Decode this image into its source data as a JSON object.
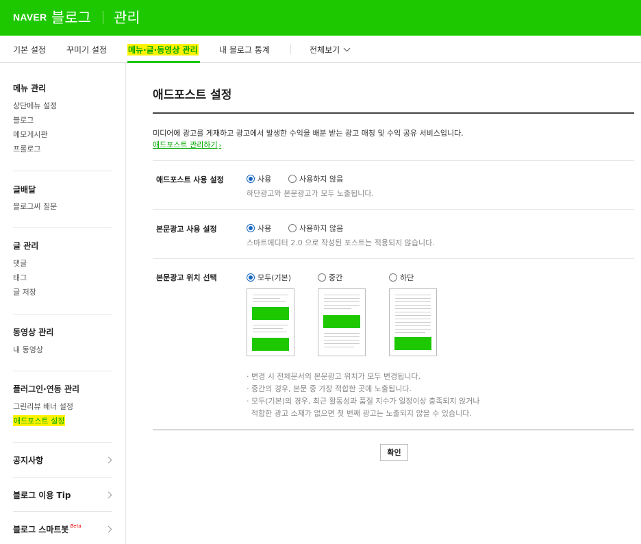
{
  "header": {
    "logo": "NAVER",
    "blog": "블로그",
    "manage": "관리",
    "background": "#1ec800"
  },
  "nav": {
    "tabs": [
      "기본 설정",
      "꾸미기 설정",
      "메뉴·글·동영상 관리",
      "내 블로그 통계"
    ],
    "view_all": "전체보기",
    "active_index": 2
  },
  "sidebar": {
    "menu_manage": {
      "title": "메뉴 관리",
      "items": [
        "상단메뉴 설정",
        "블로그",
        "메모게시판",
        "프롤로그"
      ]
    },
    "delivery": {
      "title": "글배달",
      "items": [
        "블로그씨 질문"
      ]
    },
    "post_manage": {
      "title": "글 관리",
      "items": [
        "댓글",
        "태그",
        "글 저장"
      ]
    },
    "video_manage": {
      "title": "동영상 관리",
      "items": [
        "내 동영상"
      ]
    },
    "plugin_manage": {
      "title": "플러그인·연동 관리",
      "items": [
        "그린리뷰 배너 설정",
        "애드포스트 설정"
      ]
    },
    "links": [
      "공지사항",
      "블로그 이용 Tip",
      "블로그 스마트봇"
    ],
    "beta": "Beta"
  },
  "main": {
    "title": "애드포스트 설정",
    "description": "미디어에 광고를 게재하고 광고에서 발생한 수익을 배분 받는 광고 매칭 및 수익 공유 서비스입니다.",
    "manage_link": "애드포스트 관리하기",
    "rows": [
      {
        "label": "애드포스트 사용 설정",
        "options": [
          "사용",
          "사용하지 않음"
        ],
        "selected": 0,
        "note": "하단광고와 본문광고가 모두 노출됩니다."
      },
      {
        "label": "본문광고 사용 설정",
        "options": [
          "사용",
          "사용하지 않음"
        ],
        "selected": 0,
        "note": "스마트에디터 2.0 으로 작성된 포스트는 적용되지 않습니다."
      },
      {
        "label": "본문광고 위치 선택",
        "options": [
          "모두(기본)",
          "중간",
          "하단"
        ],
        "selected": 0
      }
    ],
    "notes": [
      "· 변경 시 전체문서의 본문광고 위치가 모두 변경됩니다.",
      "· 중간의 경우, 본문 중 가장 적합한 곳에 노출됩니다.",
      "· 모두(기본)의 경우, 최근 활동성과 품질 지수가 일정이상 충족되지 않거나",
      "  적합한 광고 소재가 없으면 첫 번째 광고는 노출되지 않을 수 있습니다."
    ],
    "confirm": "확인"
  }
}
